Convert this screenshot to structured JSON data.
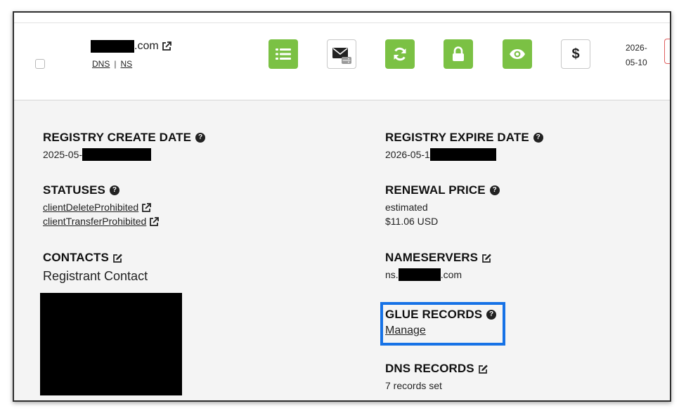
{
  "row": {
    "domain_suffix": ".com",
    "links": {
      "dns": "DNS",
      "separator": "|",
      "ns": "NS"
    },
    "toolbar_icons": [
      "list-icon",
      "mail-server-icon",
      "refresh-icon",
      "lock-icon",
      "eye-icon",
      "dollar-icon"
    ],
    "dollar_symbol": "$",
    "date_line1": "2026-",
    "date_line2": "05-10"
  },
  "details": {
    "registry_create_date": {
      "label": "REGISTRY CREATE DATE",
      "value_prefix": "2025-05-"
    },
    "registry_expire_date": {
      "label": "REGISTRY EXPIRE DATE",
      "value_prefix": "2026-05-1"
    },
    "statuses": {
      "label": "STATUSES",
      "items": [
        "clientDeleteProhibited",
        "clientTransferProhibited"
      ]
    },
    "renewal_price": {
      "label": "RENEWAL PRICE",
      "line1": "estimated",
      "line2": "$11.06 USD"
    },
    "contacts": {
      "label": "CONTACTS",
      "registrant": "Registrant Contact"
    },
    "nameservers": {
      "label": "NAMESERVERS",
      "prefix": "ns.",
      "suffix": ".com"
    },
    "glue_records": {
      "label": "GLUE RECORDS",
      "action": "Manage"
    },
    "dns_records": {
      "label": "DNS RECORDS",
      "value": "7 records set"
    }
  },
  "colors": {
    "green_button": "#7bc144",
    "highlight_border": "#1672e6"
  }
}
